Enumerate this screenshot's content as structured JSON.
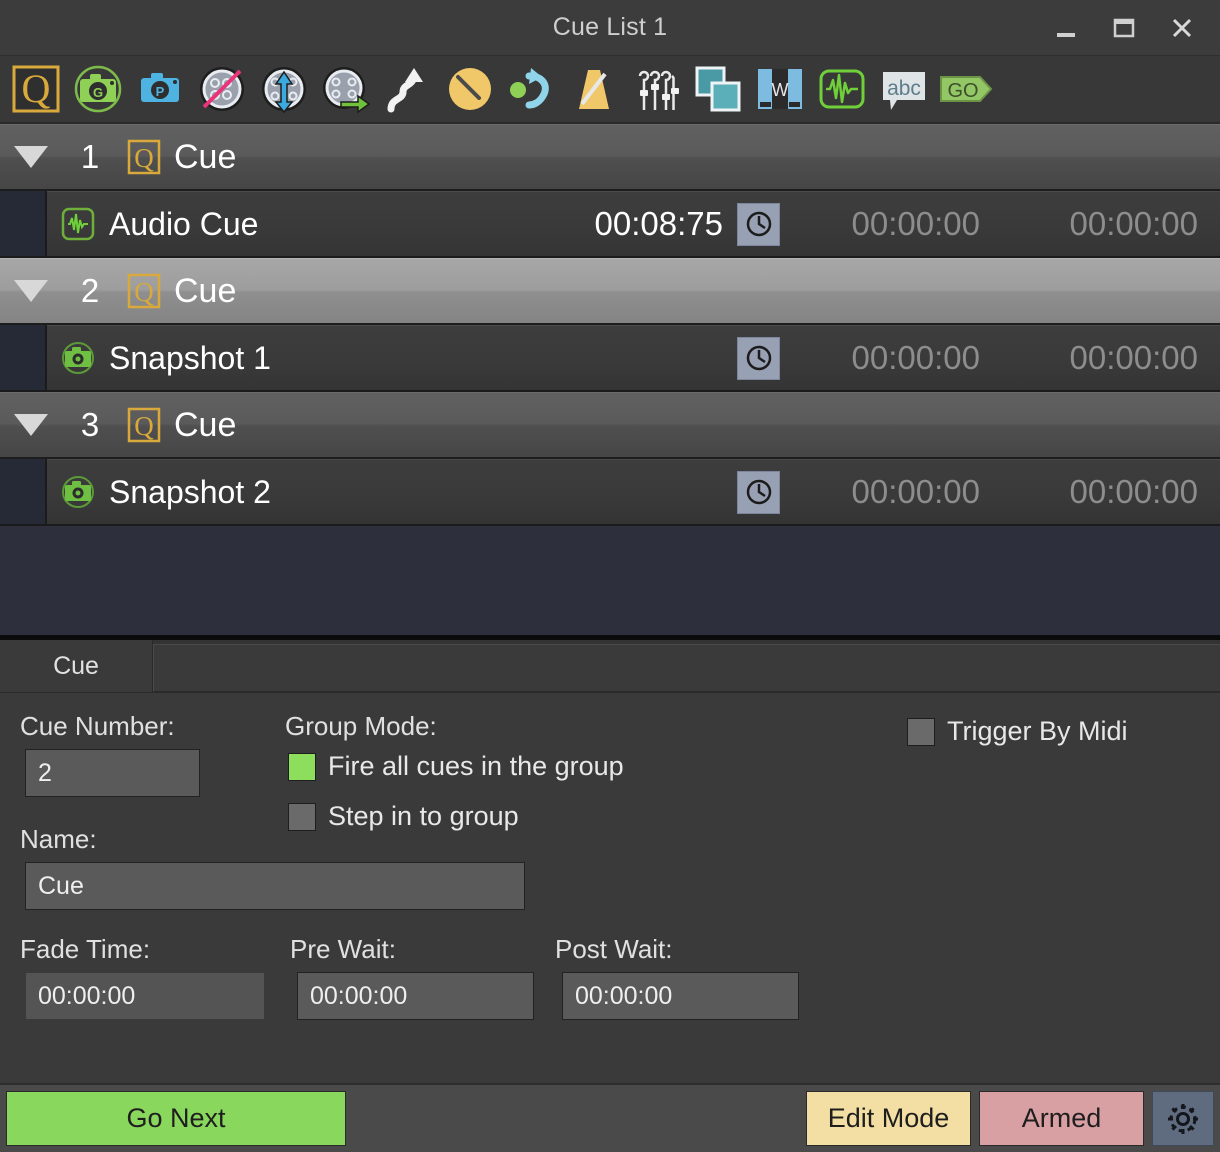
{
  "window": {
    "title": "Cue List 1",
    "controls": [
      {
        "name": "minimize",
        "glyph": "minimize-icon"
      },
      {
        "name": "maximize",
        "glyph": "maximize-icon"
      },
      {
        "name": "close",
        "glyph": "close-icon"
      }
    ]
  },
  "toolbar": {
    "buttons": [
      {
        "name": "cue-icon",
        "label": "Cue"
      },
      {
        "name": "snapshot-go-camera-icon",
        "label": "Snapshot Go"
      },
      {
        "name": "preset-camera-icon",
        "label": "Preset"
      },
      {
        "name": "disable-snapshot-icon",
        "label": "Disable Snapshot"
      },
      {
        "name": "snapshot-update-icon",
        "label": "Update Snapshot"
      },
      {
        "name": "snapshot-recall-icon",
        "label": "Recall Snapshot"
      },
      {
        "name": "path-move-icon",
        "label": "Path"
      },
      {
        "name": "pan-dial-icon",
        "label": "Pan"
      },
      {
        "name": "rotate-icon",
        "label": "Rotate"
      },
      {
        "name": "metronome-icon",
        "label": "Metronome"
      },
      {
        "name": "faders-icon",
        "label": "Faders"
      },
      {
        "name": "layers-icon",
        "label": "Layers"
      },
      {
        "name": "video-icon",
        "label": "Video"
      },
      {
        "name": "audio-waveform-icon",
        "label": "Audio"
      },
      {
        "name": "abc-text-icon",
        "label": "Text"
      },
      {
        "name": "go-icon",
        "label": "GO"
      }
    ]
  },
  "cuelist": {
    "groups": [
      {
        "expanded": true,
        "selected": false,
        "number": "1",
        "label": "Cue",
        "icon": "cue-q-icon",
        "children": [
          {
            "icon": "audio-waveform-icon",
            "name": "Audio Cue",
            "duration": "00:08:75",
            "clock_icon": "clock-icon",
            "pre_wait": "00:00:00",
            "post_wait": "00:00:00"
          }
        ]
      },
      {
        "expanded": true,
        "selected": true,
        "number": "2",
        "label": "Cue",
        "icon": "cue-q-icon",
        "children": [
          {
            "icon": "snapshot-camera-icon",
            "name": "Snapshot 1",
            "duration": "",
            "clock_icon": "clock-icon",
            "pre_wait": "00:00:00",
            "post_wait": "00:00:00"
          }
        ]
      },
      {
        "expanded": true,
        "selected": false,
        "number": "3",
        "label": "Cue",
        "icon": "cue-q-icon",
        "children": [
          {
            "icon": "snapshot-camera-icon",
            "name": "Snapshot 2",
            "duration": "",
            "clock_icon": "clock-icon",
            "pre_wait": "00:00:00",
            "post_wait": "00:00:00"
          }
        ]
      }
    ]
  },
  "inspector": {
    "tabs": [
      {
        "label": "Cue",
        "active": true
      }
    ],
    "cue_number_label": "Cue Number:",
    "cue_number_value": "2",
    "name_label": "Name:",
    "name_value": "Cue",
    "group_mode_label": "Group Mode:",
    "group_mode_options": [
      {
        "label": "Fire all cues in the group",
        "checked": true
      },
      {
        "label": "Step in to group",
        "checked": false
      }
    ],
    "trigger_by_midi": {
      "label": "Trigger By Midi",
      "checked": false
    },
    "fade_time_label": "Fade Time:",
    "fade_time_value": "00:00:00",
    "pre_wait_label": "Pre Wait:",
    "pre_wait_value": "00:00:00",
    "post_wait_label": "Post Wait:",
    "post_wait_value": "00:00:00"
  },
  "buttonbar": {
    "go_next": "Go Next",
    "edit_mode": "Edit Mode",
    "armed": "Armed",
    "settings_icon": "gear-icon"
  },
  "colors": {
    "go_next_green": "#8ad75d",
    "edit_mode_cream": "#f3dfa3",
    "armed_rose": "#d9a0a4",
    "checkbox_on_green": "#8ede5e",
    "list_background": "#2d303c",
    "clock_button": "#98a0b4"
  }
}
